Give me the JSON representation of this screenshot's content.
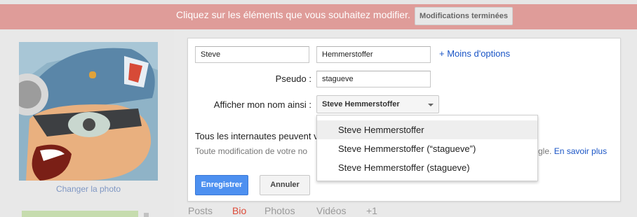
{
  "banner": {
    "message": "Cliquez sur les éléments que vous souhaitez modifier.",
    "done_button": "Modifications terminées"
  },
  "profile": {
    "change_photo": "Changer la photo"
  },
  "editor": {
    "first_name_value": "Steve",
    "last_name_value": "Hemmerstoffer",
    "more_options": "+ Moins d'options",
    "nickname_label": "Pseudo :",
    "nickname_value": "stagueve",
    "display_label": "Afficher mon nom ainsi :",
    "display_selected": "Steve Hemmerstoffer",
    "visibility_text": "Tous les internautes peuvent v",
    "note_left": "Toute modification de votre no",
    "note_right": "gle.",
    "learn_more": "En savoir plus",
    "save_button": "Enregistrer",
    "cancel_button": "Annuler"
  },
  "dropdown": {
    "options": [
      "Steve Hemmerstoffer",
      "Steve Hemmerstoffer (“stagueve”)",
      "Steve Hemmerstoffer (stagueve)"
    ]
  },
  "tabs": [
    "Posts",
    "Bio",
    "Photos",
    "Vidéos",
    "+1"
  ],
  "colors": {
    "banner": "#df9c99",
    "accent_blue": "#4d90f0",
    "link_blue": "#1a55c6",
    "active_tab": "#dd4b39"
  }
}
